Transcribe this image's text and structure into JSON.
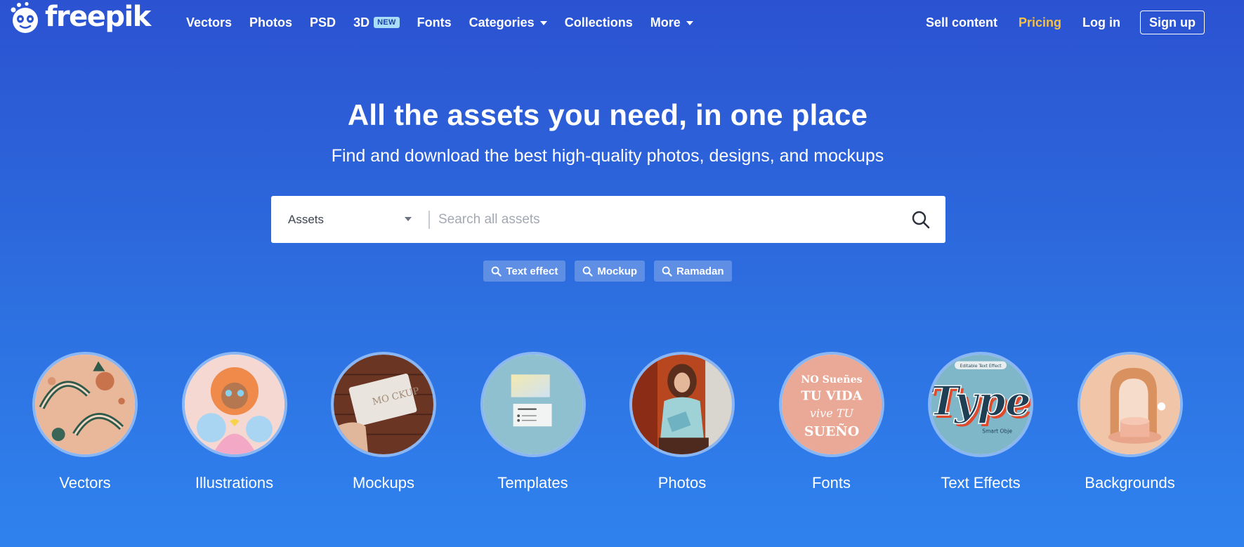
{
  "brand": {
    "name": "freepik"
  },
  "nav": {
    "items": [
      {
        "label": "Vectors"
      },
      {
        "label": "Photos"
      },
      {
        "label": "PSD"
      },
      {
        "label": "3D",
        "badge": "NEW"
      },
      {
        "label": "Fonts"
      },
      {
        "label": "Categories",
        "dropdown": true
      },
      {
        "label": "Collections"
      },
      {
        "label": "More",
        "dropdown": true
      }
    ]
  },
  "header_right": {
    "sell": "Sell content",
    "pricing": "Pricing",
    "login": "Log in",
    "signup": "Sign up"
  },
  "hero": {
    "title": "All the assets you need, in one place",
    "subtitle": "Find and download the best high-quality photos, designs, and mockups"
  },
  "search": {
    "asset_type": "Assets",
    "placeholder": "Search all assets"
  },
  "suggestions": [
    "Text effect",
    "Mockup",
    "Ramadan"
  ],
  "categories": [
    {
      "label": "Vectors"
    },
    {
      "label": "Illustrations"
    },
    {
      "label": "Mockups"
    },
    {
      "label": "Templates"
    },
    {
      "label": "Photos"
    },
    {
      "label": "Fonts"
    },
    {
      "label": "Text Effects"
    },
    {
      "label": "Backgrounds"
    }
  ],
  "thumb_text": {
    "mockup": "MO CKUP",
    "fonts_lines": [
      "NO Sueñes",
      "TU VIDA",
      "vive TU",
      "SUEÑO"
    ],
    "type_tag": "Editable Text Effect",
    "type_word": "Type",
    "type_sub": "Smart Obje"
  },
  "colors": {
    "pricing": "#f5c044",
    "bg_top": "#2b52d1",
    "bg_bottom": "#2f82ee",
    "chip": "#5e8fe5"
  }
}
